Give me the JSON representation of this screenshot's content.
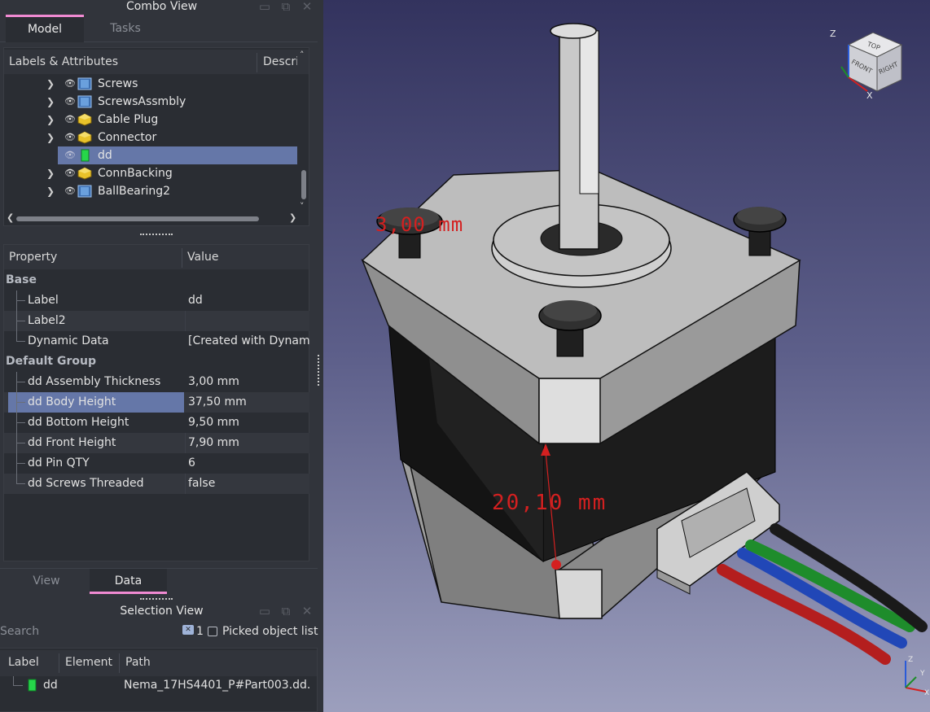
{
  "combo_view": {
    "title": "Combo View",
    "tabs": [
      "Model",
      "Tasks"
    ],
    "tree_header": {
      "col1": "Labels & Attributes",
      "col2": "Descri"
    },
    "tree_items": [
      {
        "label": "Screws",
        "icon": "assembly-icon"
      },
      {
        "label": "ScrewsAssmbly",
        "icon": "assembly-icon"
      },
      {
        "label": "Cable Plug",
        "icon": "part-icon"
      },
      {
        "label": "Connector",
        "icon": "part-icon"
      },
      {
        "label": "dd",
        "icon": "spreadsheet-icon"
      },
      {
        "label": "ConnBacking",
        "icon": "part-icon"
      },
      {
        "label": "BallBearing2",
        "icon": "assembly-icon"
      }
    ],
    "splitter": "-----"
  },
  "property_editor": {
    "header": {
      "col1": "Property",
      "col2": "Value"
    },
    "groups": [
      {
        "name": "Base",
        "rows": [
          {
            "name": "Label",
            "value": "dd"
          },
          {
            "name": "Label2",
            "value": ""
          },
          {
            "name": "Dynamic Data",
            "value": "[Created with Dynam..."
          }
        ]
      },
      {
        "name": "Default Group",
        "rows": [
          {
            "name": "dd Assembly Thickness",
            "value": "3,00 mm"
          },
          {
            "name": "dd Body Height",
            "value": "37,50 mm"
          },
          {
            "name": "dd Bottom Height",
            "value": "9,50 mm"
          },
          {
            "name": "dd Front Height",
            "value": "7,90 mm"
          },
          {
            "name": "dd Pin QTY",
            "value": "6"
          },
          {
            "name": "dd Screws Threaded",
            "value": "false"
          }
        ]
      }
    ],
    "bottom_tabs": [
      "View",
      "Data"
    ],
    "splitter": "-----"
  },
  "selection_view": {
    "title": "Selection View",
    "search_placeholder": "Search",
    "count": "1",
    "picked_label": "Picked object list",
    "columns": [
      "Label",
      "Element",
      "Path"
    ],
    "rows": [
      {
        "label": "dd",
        "element": "",
        "path": "Nema_17HS4401_P#Part003.dd."
      }
    ]
  },
  "viewport": {
    "dimension_labels": [
      "3,00 mm",
      "20,10 mm"
    ],
    "navcube_faces": [
      "TOP",
      "FRONT",
      "RIGHT"
    ],
    "axis_labels": {
      "x": "X",
      "y": "Y",
      "z": "Z"
    },
    "colors": {
      "dimension": "#d42020",
      "selection": "#6577a8",
      "tab_accent": "#f08ad2"
    }
  }
}
